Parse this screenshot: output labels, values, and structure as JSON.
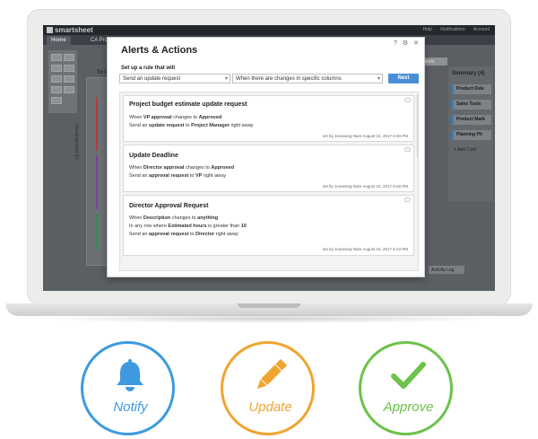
{
  "app": {
    "logo": "smartsheet",
    "top_links": [
      "Help",
      "Notifications",
      "Account"
    ],
    "tabs": [
      "Home",
      "CA Prod"
    ],
    "fields_button": "Fields",
    "summary_title": "Summary (4)",
    "summary_cards": [
      "Product Rele",
      "Sales Tools",
      "Product Mark",
      "Planning Ph"
    ],
    "add_card": "Add Card",
    "activity_log": "Activity Log",
    "column_label": "To D",
    "lane_label": "Uncategorized (6)"
  },
  "dialog": {
    "title": "Alerts & Actions",
    "icons": [
      "question-icon",
      "gear-icon",
      "close-icon"
    ],
    "setup_label": "Set up a rule that will",
    "action_select": "Send an update request",
    "trigger_select": "When there are changes in specific columns",
    "next_label": "Next",
    "rules": [
      {
        "title": "Project budget estimate update request",
        "line1": {
          "a": "When ",
          "b": "VP approval",
          "c": " changes to ",
          "d": "Approved"
        },
        "line2": {
          "a": "Send an ",
          "b": "update request",
          "c": " to ",
          "d": "Project Manager",
          "e": " right away"
        },
        "meta": "set by Jooseung Nam  August 15, 2017 6:48 PM"
      },
      {
        "title": "Update Deadline",
        "line1": {
          "a": "When ",
          "b": "Director approval",
          "c": " changes to ",
          "d": "Approved"
        },
        "line2": {
          "a": "Send an ",
          "b": "approval request",
          "c": " to ",
          "d": "VP",
          "e": " right away"
        },
        "meta": "set by Jooseung Nam  August 15, 2017 6:46 PM"
      },
      {
        "title": "Director Approval Request",
        "line1": {
          "a": "When ",
          "b": "Description",
          "c": " changes to ",
          "d": "anything"
        },
        "line1b": {
          "a": "In any row where ",
          "b": "Estimated hours",
          "c": " is greater than ",
          "d": "10"
        },
        "line2": {
          "a": "Send an ",
          "b": "approval request",
          "c": " to ",
          "d": "Director",
          "e": " right away"
        },
        "meta": "set by Jooseung Nam  August 15, 2017 6:43 PM"
      }
    ]
  },
  "features": [
    {
      "label": "Notify",
      "icon": "bell-icon",
      "color": "#3d9ae0"
    },
    {
      "label": "Update",
      "icon": "pencil-icon",
      "color": "#f0a431"
    },
    {
      "label": "Approve",
      "icon": "checkmark-icon",
      "color": "#6cc24a"
    }
  ]
}
